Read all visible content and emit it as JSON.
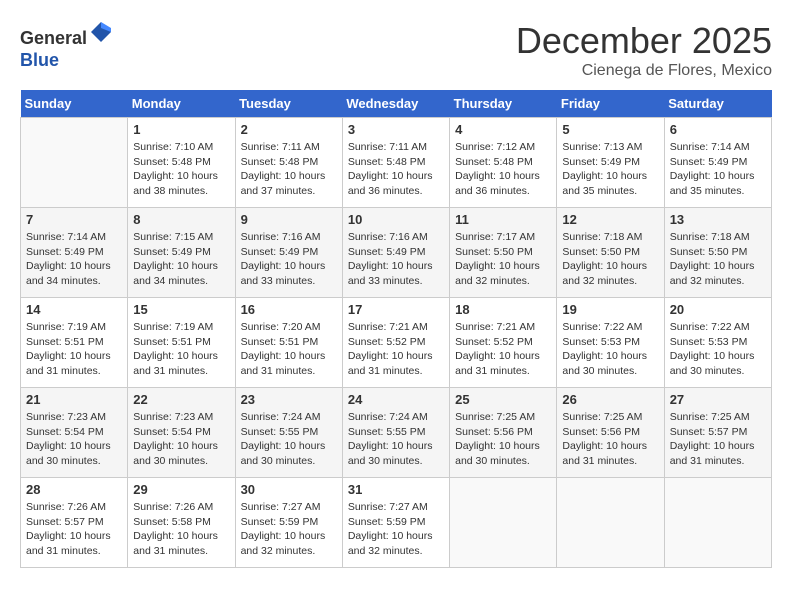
{
  "logo": {
    "line1": "General",
    "line2": "Blue"
  },
  "title": "December 2025",
  "location": "Cienega de Flores, Mexico",
  "days_header": [
    "Sunday",
    "Monday",
    "Tuesday",
    "Wednesday",
    "Thursday",
    "Friday",
    "Saturday"
  ],
  "weeks": [
    [
      {
        "day": "",
        "info": ""
      },
      {
        "day": "1",
        "info": "Sunrise: 7:10 AM\nSunset: 5:48 PM\nDaylight: 10 hours\nand 38 minutes."
      },
      {
        "day": "2",
        "info": "Sunrise: 7:11 AM\nSunset: 5:48 PM\nDaylight: 10 hours\nand 37 minutes."
      },
      {
        "day": "3",
        "info": "Sunrise: 7:11 AM\nSunset: 5:48 PM\nDaylight: 10 hours\nand 36 minutes."
      },
      {
        "day": "4",
        "info": "Sunrise: 7:12 AM\nSunset: 5:48 PM\nDaylight: 10 hours\nand 36 minutes."
      },
      {
        "day": "5",
        "info": "Sunrise: 7:13 AM\nSunset: 5:49 PM\nDaylight: 10 hours\nand 35 minutes."
      },
      {
        "day": "6",
        "info": "Sunrise: 7:14 AM\nSunset: 5:49 PM\nDaylight: 10 hours\nand 35 minutes."
      }
    ],
    [
      {
        "day": "7",
        "info": "Sunrise: 7:14 AM\nSunset: 5:49 PM\nDaylight: 10 hours\nand 34 minutes."
      },
      {
        "day": "8",
        "info": "Sunrise: 7:15 AM\nSunset: 5:49 PM\nDaylight: 10 hours\nand 34 minutes."
      },
      {
        "day": "9",
        "info": "Sunrise: 7:16 AM\nSunset: 5:49 PM\nDaylight: 10 hours\nand 33 minutes."
      },
      {
        "day": "10",
        "info": "Sunrise: 7:16 AM\nSunset: 5:49 PM\nDaylight: 10 hours\nand 33 minutes."
      },
      {
        "day": "11",
        "info": "Sunrise: 7:17 AM\nSunset: 5:50 PM\nDaylight: 10 hours\nand 32 minutes."
      },
      {
        "day": "12",
        "info": "Sunrise: 7:18 AM\nSunset: 5:50 PM\nDaylight: 10 hours\nand 32 minutes."
      },
      {
        "day": "13",
        "info": "Sunrise: 7:18 AM\nSunset: 5:50 PM\nDaylight: 10 hours\nand 32 minutes."
      }
    ],
    [
      {
        "day": "14",
        "info": "Sunrise: 7:19 AM\nSunset: 5:51 PM\nDaylight: 10 hours\nand 31 minutes."
      },
      {
        "day": "15",
        "info": "Sunrise: 7:19 AM\nSunset: 5:51 PM\nDaylight: 10 hours\nand 31 minutes."
      },
      {
        "day": "16",
        "info": "Sunrise: 7:20 AM\nSunset: 5:51 PM\nDaylight: 10 hours\nand 31 minutes."
      },
      {
        "day": "17",
        "info": "Sunrise: 7:21 AM\nSunset: 5:52 PM\nDaylight: 10 hours\nand 31 minutes."
      },
      {
        "day": "18",
        "info": "Sunrise: 7:21 AM\nSunset: 5:52 PM\nDaylight: 10 hours\nand 31 minutes."
      },
      {
        "day": "19",
        "info": "Sunrise: 7:22 AM\nSunset: 5:53 PM\nDaylight: 10 hours\nand 30 minutes."
      },
      {
        "day": "20",
        "info": "Sunrise: 7:22 AM\nSunset: 5:53 PM\nDaylight: 10 hours\nand 30 minutes."
      }
    ],
    [
      {
        "day": "21",
        "info": "Sunrise: 7:23 AM\nSunset: 5:54 PM\nDaylight: 10 hours\nand 30 minutes."
      },
      {
        "day": "22",
        "info": "Sunrise: 7:23 AM\nSunset: 5:54 PM\nDaylight: 10 hours\nand 30 minutes."
      },
      {
        "day": "23",
        "info": "Sunrise: 7:24 AM\nSunset: 5:55 PM\nDaylight: 10 hours\nand 30 minutes."
      },
      {
        "day": "24",
        "info": "Sunrise: 7:24 AM\nSunset: 5:55 PM\nDaylight: 10 hours\nand 30 minutes."
      },
      {
        "day": "25",
        "info": "Sunrise: 7:25 AM\nSunset: 5:56 PM\nDaylight: 10 hours\nand 30 minutes."
      },
      {
        "day": "26",
        "info": "Sunrise: 7:25 AM\nSunset: 5:56 PM\nDaylight: 10 hours\nand 31 minutes."
      },
      {
        "day": "27",
        "info": "Sunrise: 7:25 AM\nSunset: 5:57 PM\nDaylight: 10 hours\nand 31 minutes."
      }
    ],
    [
      {
        "day": "28",
        "info": "Sunrise: 7:26 AM\nSunset: 5:57 PM\nDaylight: 10 hours\nand 31 minutes."
      },
      {
        "day": "29",
        "info": "Sunrise: 7:26 AM\nSunset: 5:58 PM\nDaylight: 10 hours\nand 31 minutes."
      },
      {
        "day": "30",
        "info": "Sunrise: 7:27 AM\nSunset: 5:59 PM\nDaylight: 10 hours\nand 32 minutes."
      },
      {
        "day": "31",
        "info": "Sunrise: 7:27 AM\nSunset: 5:59 PM\nDaylight: 10 hours\nand 32 minutes."
      },
      {
        "day": "",
        "info": ""
      },
      {
        "day": "",
        "info": ""
      },
      {
        "day": "",
        "info": ""
      }
    ]
  ]
}
